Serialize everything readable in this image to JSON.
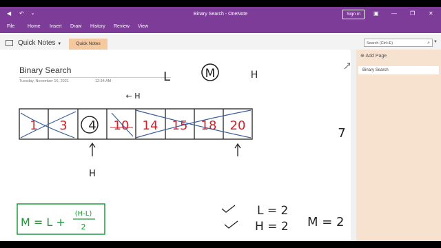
{
  "window": {
    "title": "Binary Search - OneNote",
    "signin_label": "Sign in"
  },
  "menu": [
    "File",
    "Home",
    "Insert",
    "Draw",
    "History",
    "Review",
    "View"
  ],
  "notebook": {
    "name": "Quick Notes",
    "tab": "Quick Notes"
  },
  "search": {
    "placeholder": "Search (Ctrl+E)"
  },
  "page": {
    "title": "Binary Search",
    "date": "Tuesday, November 16, 2021",
    "time": "12:34 AM"
  },
  "sidepanel": {
    "add_page_label": "Add Page",
    "pages": [
      "Binary Search"
    ]
  },
  "ink": {
    "labels_top": [
      "L",
      "M",
      "H"
    ],
    "array": [
      "1",
      "3",
      "4",
      "10",
      "14",
      "15",
      "18",
      "20"
    ],
    "arrow_label": "H",
    "side_number": "7",
    "aside": "← H",
    "formula": "M = L + (H-L) / 2",
    "formula_parts": {
      "lhs": "M = L +",
      "num": "(H-L)",
      "den": "2"
    },
    "values": [
      "L = 2",
      "H = 2",
      "M = 2"
    ]
  }
}
